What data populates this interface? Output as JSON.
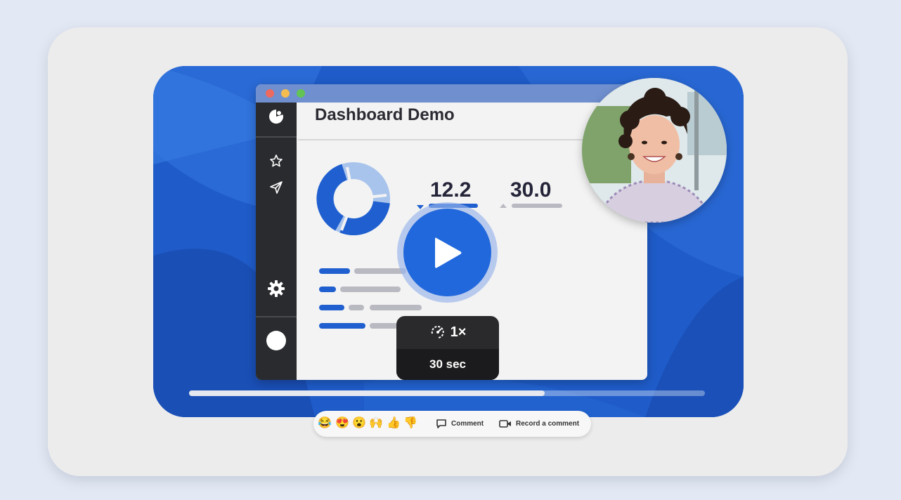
{
  "window": {
    "title": "Dashboard Demo",
    "traffic_colors": [
      "#ee6a5f",
      "#f5bd4f",
      "#61c454"
    ]
  },
  "metrics": [
    {
      "value": "12.2",
      "trend": "down"
    },
    {
      "value": "30.0",
      "trend": "up"
    }
  ],
  "sidebar": {
    "icons": [
      "logo-icon",
      "star-icon",
      "send-icon",
      "gear-icon",
      "profile-icon"
    ]
  },
  "player": {
    "speed_label": "1×",
    "duration_label": "30 sec",
    "progress": 0.69,
    "play_icon": "play-icon"
  },
  "reactions": {
    "emojis": [
      "😂",
      "😍",
      "😮",
      "🙌",
      "👍",
      "👎"
    ],
    "comment_label": "Comment",
    "record_label": "Record a comment"
  },
  "colors": {
    "accent": "#2168dc",
    "video_bg": "#1f5cc9",
    "card_bg": "#ececec",
    "page_bg": "#e3e9f4"
  }
}
